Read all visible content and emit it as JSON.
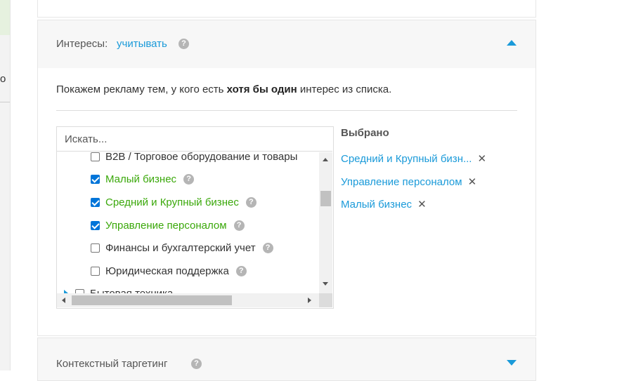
{
  "left_strip": {
    "glyph": "o"
  },
  "interests": {
    "label": "Интересы:",
    "mode_link": "учитывать",
    "help": "?",
    "description_before": "Покажем рекламу тем, у кого есть ",
    "description_bold": "хотя бы один",
    "description_after": " интерес из списка.",
    "search_placeholder": "Искать...",
    "items": [
      {
        "label": "B2B / Торговое оборудование и товары",
        "checked": false,
        "help": ""
      },
      {
        "label": "Малый бизнес",
        "checked": true,
        "help": "?"
      },
      {
        "label": "Средний и Крупный бизнес",
        "checked": true,
        "help": "?"
      },
      {
        "label": "Управление персоналом",
        "checked": true,
        "help": "?"
      },
      {
        "label": "Финансы и бухгалтерский учет",
        "checked": false,
        "help": "?"
      },
      {
        "label": "Юридическая поддержка",
        "checked": false,
        "help": "?"
      },
      {
        "label": "Бытовая техника",
        "checked": false,
        "help": ""
      }
    ],
    "selected_title": "Выбрано",
    "selected": [
      {
        "label": "Средний и Крупный бизн...",
        "remove": "✕"
      },
      {
        "label": "Управление персоналом",
        "remove": "✕"
      },
      {
        "label": "Малый бизнес",
        "remove": "✕"
      }
    ]
  },
  "context": {
    "label": "Контекстный таргетинг",
    "help": "?"
  },
  "colors": {
    "accent": "#1a9ad9",
    "selected_text": "#3aa80a",
    "checkbox": "#0075d9"
  }
}
